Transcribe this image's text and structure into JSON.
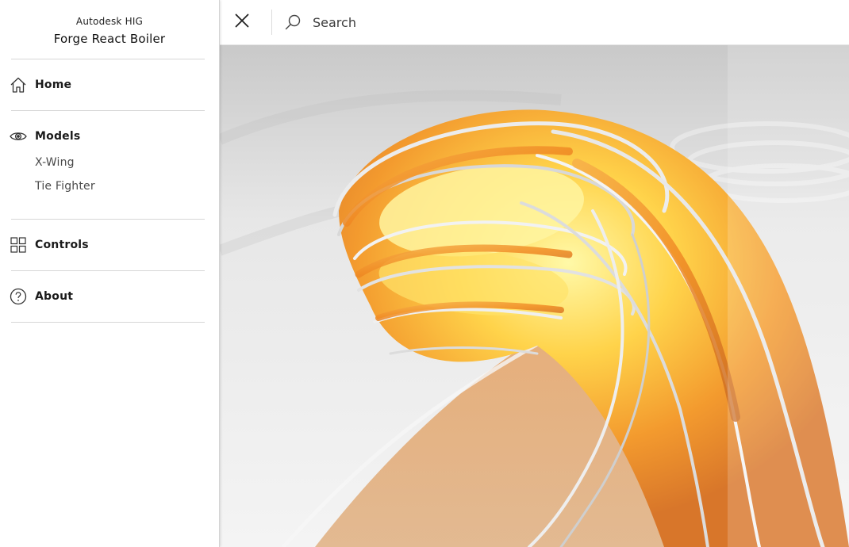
{
  "brand": {
    "org": "Autodesk HIG",
    "app_name": "Forge React Boiler"
  },
  "nav": {
    "home": {
      "label": "Home",
      "icon": "home-icon"
    },
    "models": {
      "label": "Models",
      "icon": "eye-icon",
      "items": [
        {
          "label": "X-Wing"
        },
        {
          "label": "Tie Fighter"
        }
      ]
    },
    "controls": {
      "label": "Controls",
      "icon": "grid-icon"
    },
    "about": {
      "label": "About",
      "icon": "help-circle-icon"
    }
  },
  "topbar": {
    "close_icon": "close-icon",
    "search_icon": "search-icon",
    "search_placeholder": "Search",
    "search_value": ""
  },
  "hero": {
    "image": "abstract-orange-swirl-illustration"
  },
  "colors": {
    "accent_orange": "#f08a24",
    "accent_yellow": "#ffe85a",
    "text_primary": "#1a1a1a",
    "divider": "#d6d6d6"
  }
}
